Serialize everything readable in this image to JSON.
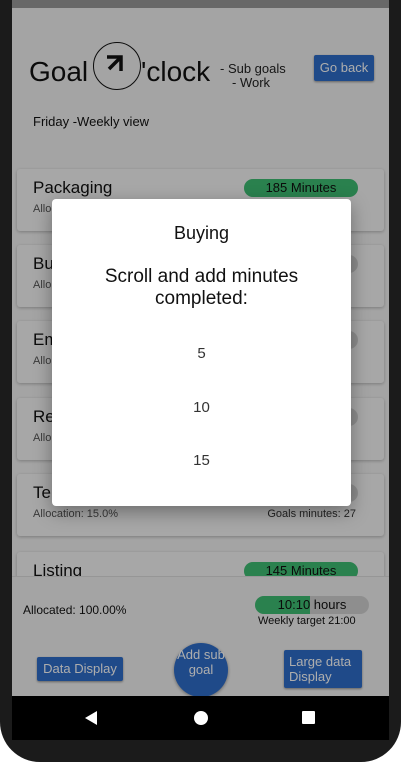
{
  "header": {
    "logo_left": "Goal",
    "logo_right": "'clock",
    "subtitle_line1": "- Sub goals",
    "subtitle_line2": "- Work",
    "go_back_label": "Go back",
    "day_label": "Friday -Weekly view"
  },
  "cards": [
    {
      "title": "Packaging",
      "allocation": "Allocation:",
      "pill_text": "185 Minutes",
      "progress": 1.0,
      "goal_minutes": ""
    },
    {
      "title": "Bu",
      "allocation": "Allo",
      "pill_text": "",
      "progress": 0.0,
      "goal_minutes": ""
    },
    {
      "title": "Em",
      "allocation": "Allo",
      "pill_text": "",
      "progress": 0.0,
      "goal_minutes": ""
    },
    {
      "title": "Re",
      "allocation": "Allo",
      "pill_text": "",
      "progress": 0.0,
      "goal_minutes": ""
    },
    {
      "title": "Te",
      "allocation": "Allocation: 15.0%",
      "pill_text": "",
      "progress": 0.0,
      "goal_minutes": "Goals minutes: 27"
    },
    {
      "title": "Listing",
      "allocation": "",
      "pill_text": "145 Minutes",
      "progress": 1.0,
      "goal_minutes": ""
    }
  ],
  "bottom": {
    "allocated": "Allocated: 100.00%",
    "hours_text": "10:10 hours",
    "hours_progress": 0.48,
    "weekly_target": "Weekly target 21:00",
    "data_display_label": "Data Display",
    "add_sub_goal_label": "Add sub goal",
    "large_display_label": "Large data Display"
  },
  "dialog": {
    "title": "Buying",
    "message": "Scroll and add minutes completed:",
    "options": [
      "5",
      "10",
      "15"
    ]
  },
  "colors": {
    "accent_blue": "#2f6ecb",
    "progress_green": "#3fbf73"
  },
  "nav": {
    "back_icon": "back-triangle-icon",
    "home_icon": "home-circle-icon",
    "recent_icon": "recent-square-icon"
  }
}
